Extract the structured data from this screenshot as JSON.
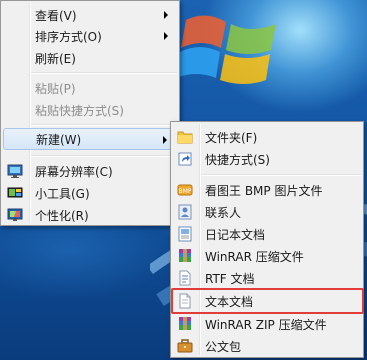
{
  "context_menu": {
    "items": [
      {
        "label": "查看(V)",
        "submenu": true,
        "enabled": true
      },
      {
        "label": "排序方式(O)",
        "submenu": true,
        "enabled": true
      },
      {
        "label": "刷新(E)",
        "submenu": false,
        "enabled": true
      },
      {
        "label": "粘贴(P)",
        "submenu": false,
        "enabled": false
      },
      {
        "label": "粘贴快捷方式(S)",
        "submenu": false,
        "enabled": false
      },
      {
        "label": "新建(W)",
        "submenu": true,
        "enabled": true,
        "highlighted": true
      },
      {
        "label": "屏幕分辨率(C)",
        "icon": "display-settings-icon"
      },
      {
        "label": "小工具(G)",
        "icon": "gadgets-icon"
      },
      {
        "label": "个性化(R)",
        "icon": "personalize-icon"
      }
    ]
  },
  "new_submenu": {
    "items": [
      {
        "label": "文件夹(F)",
        "icon": "folder-icon"
      },
      {
        "label": "快捷方式(S)",
        "icon": "shortcut-icon"
      },
      {
        "label": "看图王 BMP 图片文件",
        "icon": "bmp-file-icon"
      },
      {
        "label": "联系人",
        "icon": "contact-icon"
      },
      {
        "label": "日记本文档",
        "icon": "journal-document-icon"
      },
      {
        "label": "WinRAR 压缩文件",
        "icon": "winrar-archive-icon"
      },
      {
        "label": "RTF 文档",
        "icon": "rtf-document-icon"
      },
      {
        "label": "文本文档",
        "icon": "text-document-icon",
        "annotated": true
      },
      {
        "label": "WinRAR ZIP 压缩文件",
        "icon": "winrar-zip-icon"
      },
      {
        "label": "公文包",
        "icon": "briefcase-icon"
      }
    ]
  },
  "annotation": {
    "color": "#e23b3b"
  }
}
